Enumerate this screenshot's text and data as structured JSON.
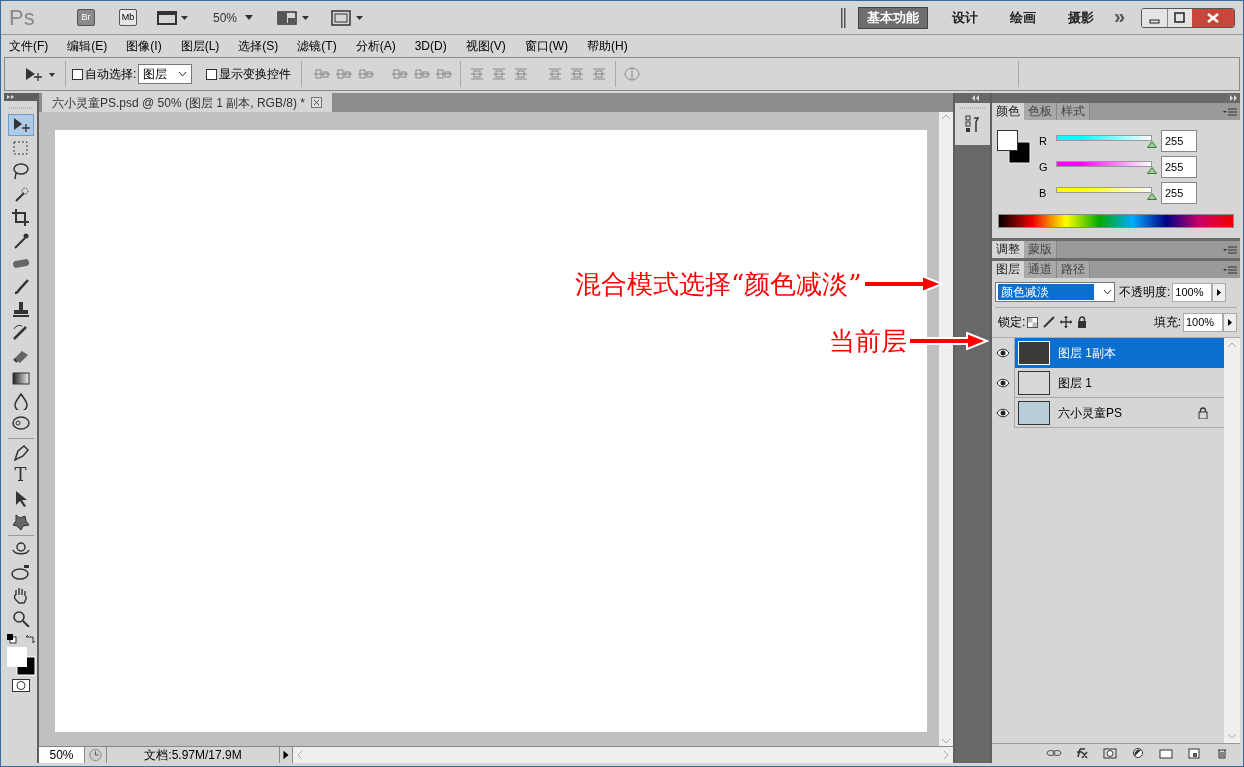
{
  "title_bar": {
    "app_logo": "Ps",
    "bridge": "Br",
    "mini_bridge": "Mb",
    "zoom": "50%",
    "workspaces": [
      {
        "label": "基本功能",
        "selected": true
      },
      {
        "label": "设计",
        "selected": false
      },
      {
        "label": "绘画",
        "selected": false
      },
      {
        "label": "摄影",
        "selected": false
      }
    ],
    "more": "»"
  },
  "menu": [
    "文件(F)",
    "编辑(E)",
    "图像(I)",
    "图层(L)",
    "选择(S)",
    "滤镜(T)",
    "分析(A)",
    "3D(D)",
    "视图(V)",
    "窗口(W)",
    "帮助(H)"
  ],
  "options_bar": {
    "auto_select": {
      "label": "自动选择:",
      "checked": false
    },
    "auto_select_target": "图层",
    "show_transform": {
      "label": "显示变换控件",
      "checked": false
    }
  },
  "tools": [
    {
      "kind": "move",
      "selected": true
    },
    {
      "kind": "marquee",
      "selected": false
    },
    {
      "kind": "lasso",
      "selected": false
    },
    {
      "kind": "wand",
      "selected": false
    },
    {
      "kind": "crop",
      "selected": false
    },
    {
      "kind": "eyedropper",
      "selected": false
    },
    {
      "kind": "healing",
      "selected": false
    },
    {
      "kind": "brush",
      "selected": false
    },
    {
      "kind": "stamp",
      "selected": false
    },
    {
      "kind": "history",
      "selected": false
    },
    {
      "kind": "eraser",
      "selected": false
    },
    {
      "kind": "gradient",
      "selected": false
    },
    {
      "kind": "blur",
      "selected": false
    },
    {
      "kind": "dodge",
      "selected": false
    },
    {
      "kind": "pen",
      "selected": false
    },
    {
      "kind": "type",
      "selected": false,
      "glyph": "T"
    },
    {
      "kind": "path",
      "selected": false
    },
    {
      "kind": "shape",
      "selected": false
    },
    {
      "kind": "rotate3d",
      "selected": false
    },
    {
      "kind": "orbit3d",
      "selected": false
    },
    {
      "kind": "hand",
      "selected": false
    },
    {
      "kind": "zoom",
      "selected": false
    }
  ],
  "document": {
    "tab_title": "六小灵童PS.psd @ 50% (图层 1 副本, RGB/8) *",
    "zoom": "50%",
    "doc_info": "文档:5.97M/17.9M"
  },
  "color_panel": {
    "tabs": [
      {
        "label": "颜色",
        "selected": true
      },
      {
        "label": "色板",
        "selected": false
      },
      {
        "label": "样式",
        "selected": false
      }
    ],
    "channels": [
      {
        "label": "R",
        "value": "255",
        "color": "#00ffff",
        "level": 1
      },
      {
        "label": "G",
        "value": "255",
        "color": "#ff00ff",
        "level": 1
      },
      {
        "label": "B",
        "value": "255",
        "color": "#ffff00",
        "level": 1
      }
    ]
  },
  "adjust_panel": {
    "tabs": [
      {
        "label": "调整",
        "selected": true
      },
      {
        "label": "蒙版",
        "selected": false
      }
    ]
  },
  "layers_panel": {
    "tabs": [
      {
        "label": "图层",
        "selected": true
      },
      {
        "label": "通道",
        "selected": false
      },
      {
        "label": "路径",
        "selected": false
      }
    ],
    "blend_mode": "颜色减淡",
    "opacity_label": "不透明度:",
    "opacity": "100%",
    "lock_label": "锁定:",
    "fill_label": "填充:",
    "fill": "100%",
    "layers": [
      {
        "name": "图层 1副本",
        "selected": true,
        "visible": true,
        "locked": false
      },
      {
        "name": "图层 1",
        "selected": false,
        "visible": true,
        "locked": false
      },
      {
        "name": "六小灵童PS",
        "selected": false,
        "visible": true,
        "locked": true
      }
    ]
  },
  "annotations": [
    {
      "text": "混合模式选择“颜色减淡”"
    },
    {
      "text": "当前层"
    }
  ]
}
